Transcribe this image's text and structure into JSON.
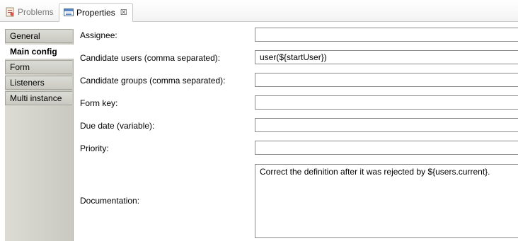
{
  "tabs": [
    {
      "label": "Problems",
      "active": false,
      "icon": "problems-icon"
    },
    {
      "label": "Properties",
      "active": true,
      "icon": "properties-icon",
      "closable": true
    }
  ],
  "sidebar": {
    "items": [
      {
        "label": "General",
        "selected": false
      },
      {
        "label": "Main config",
        "selected": true
      },
      {
        "label": "Form",
        "selected": false
      },
      {
        "label": "Listeners",
        "selected": false
      },
      {
        "label": "Multi instance",
        "selected": false
      }
    ]
  },
  "form": {
    "assignee": {
      "label": "Assignee:",
      "value": ""
    },
    "candidate_users": {
      "label": "Candidate users (comma separated):",
      "value": "user(${startUser})"
    },
    "candidate_groups": {
      "label": "Candidate groups (comma separated):",
      "value": ""
    },
    "form_key": {
      "label": "Form key:",
      "value": ""
    },
    "due_date": {
      "label": "Due date (variable):",
      "value": ""
    },
    "priority": {
      "label": "Priority:",
      "value": ""
    },
    "documentation": {
      "label": "Documentation:",
      "value": "Correct the definition after it was rejected by ${users.current}."
    }
  },
  "colors": {
    "sidebar_bg": "#c9c9c0",
    "field_border": "#8a8a8a"
  }
}
